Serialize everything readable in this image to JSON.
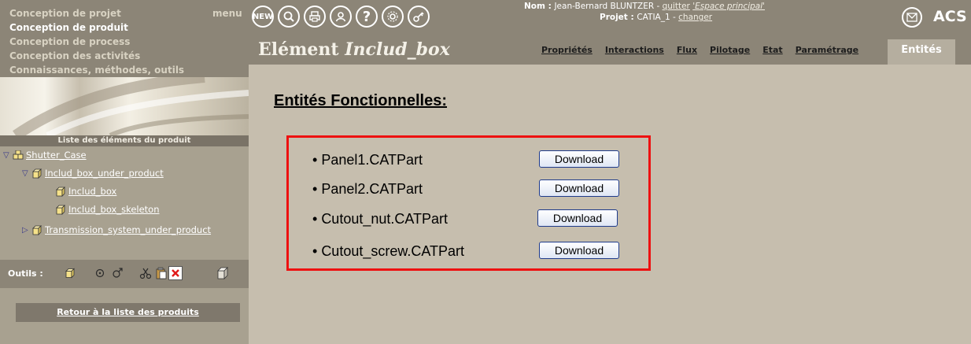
{
  "sidebar": {
    "top_menu": [
      {
        "label": "Conception de projet",
        "active": false
      },
      {
        "label": "Conception de produit",
        "active": true
      },
      {
        "label": "Conception de process",
        "active": false
      },
      {
        "label": "Conception des activités",
        "active": false
      },
      {
        "label": "Connaissances, méthodes, outils",
        "active": false
      }
    ],
    "menu_label": "menu",
    "list_title": "Liste des éléments du produit",
    "tree": [
      {
        "label": "Shutter_Case",
        "level": 0,
        "expanded": true,
        "icon": "assembly-icon"
      },
      {
        "label": "Includ_box_under_product",
        "level": 1,
        "expanded": true,
        "icon": "part-cube-icon"
      },
      {
        "label": "Includ_box",
        "level": 2,
        "icon": "part-cube-icon"
      },
      {
        "label": "Includ_box_skeleton",
        "level": 2,
        "icon": "part-cube-icon"
      },
      {
        "label": "Transmission_system_under_product",
        "level": 1,
        "expanded": false,
        "icon": "part-cube-icon"
      }
    ],
    "tools_label": "Outils :",
    "back_link": "Retour à la liste des produits"
  },
  "header": {
    "icons": [
      "new-icon",
      "search-icon",
      "print-icon",
      "user-icon",
      "help-icon",
      "settings-icon",
      "key-icon"
    ],
    "new_label": "NEW",
    "user_prefix": "Nom : ",
    "user_name": "Jean-Bernard BLUNTZER",
    "quit_link": "quitter",
    "space_link": "'Espace principal'",
    "project_prefix": "Projet : ",
    "project_name": "CATIA_1",
    "change_link": "changer",
    "brand": "ACS",
    "element_prefix": "Elément ",
    "element_name": "Includ_box",
    "tabs": [
      "Propriétés",
      "Interactions",
      "Flux",
      "Pilotage",
      "Etat",
      "Paramétrage"
    ],
    "active_tab": "Entités"
  },
  "main": {
    "section_title": "Entités Fonctionnelles:",
    "files": [
      {
        "name": "Panel1.CATPart",
        "button": "Download"
      },
      {
        "name": "Panel2.CATPart",
        "button": "Download"
      },
      {
        "name": "Cutout_nut.CATPart",
        "button": "Download"
      },
      {
        "name": "Cutout_screw.CATPart",
        "button": "Download"
      }
    ]
  },
  "colors": {
    "header_bg": "#8c8577",
    "sidebar_bg": "#a8a190",
    "main_bg": "#c6beae",
    "highlight_border": "#ee1111"
  }
}
